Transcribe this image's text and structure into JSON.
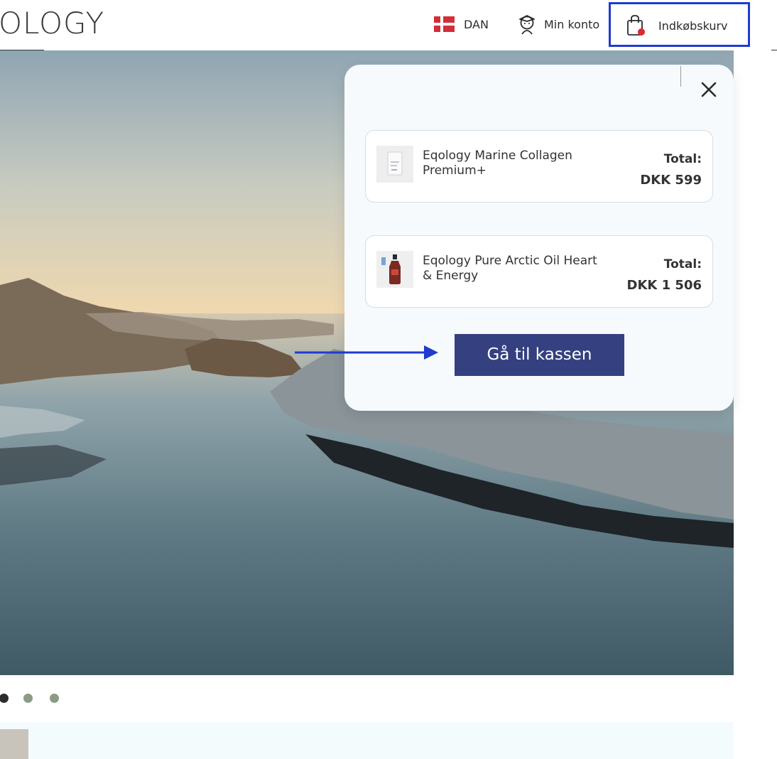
{
  "header": {
    "logo_text": "OLOGY",
    "language": {
      "label": "DAN",
      "flag_icon": "denmark-flag-icon"
    },
    "account": {
      "label": "Min konto",
      "icon": "user-icon"
    },
    "cart": {
      "label": "Indkøbskurv",
      "icon": "shopping-bag-icon",
      "highlight_color": "#1f3bd1"
    }
  },
  "cart_popup": {
    "close_icon": "close-icon",
    "items": [
      {
        "name": "Eqology Marine Collagen Premium+",
        "total_label": "Total:",
        "total_value": "DKK 599"
      },
      {
        "name": "Eqology Pure Arctic Oil Heart & Energy",
        "total_label": "Total:",
        "total_value": "DKK 1 506"
      }
    ],
    "checkout_label": "Gå til kassen",
    "checkout_color": "#34407f"
  },
  "annotation": {
    "arrow_color": "#1f3bd1"
  },
  "carousel": {
    "dot_count": 3,
    "active_index": 0,
    "active_color": "#2c2c2c",
    "inactive_color": "#8c9c84"
  }
}
